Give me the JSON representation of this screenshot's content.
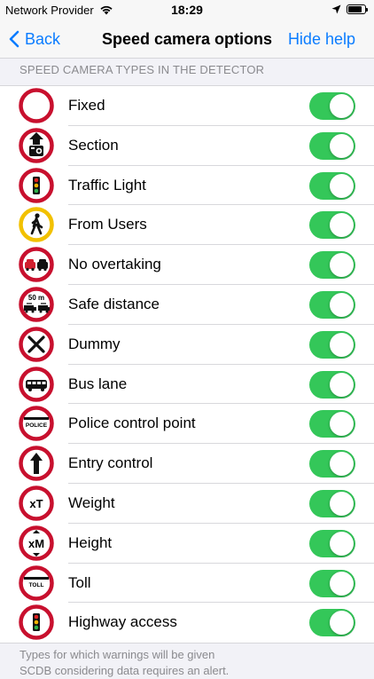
{
  "status_bar": {
    "carrier": "Network Provider",
    "time": "18:29",
    "battery_level": 0.85
  },
  "nav": {
    "back_label": "Back",
    "title": "Speed camera options",
    "help_label": "Hide help"
  },
  "section": {
    "header": "SPEED CAMERA TYPES IN THE DETECTOR",
    "footer_line1": "Types for which warnings will be given",
    "footer_line2": "SCDB considering data requires an alert."
  },
  "colors": {
    "accent": "#0a7cff",
    "toggle_on": "#34c759",
    "sign_red": "#c8102e",
    "sign_yellow": "#f2c100"
  },
  "camera_types": [
    {
      "label": "Fixed",
      "icon": "fixed-sign-icon",
      "enabled": true
    },
    {
      "label": "Section",
      "icon": "section-sign-icon",
      "enabled": true
    },
    {
      "label": "Traffic Light",
      "icon": "traffic-light-sign-icon",
      "enabled": true
    },
    {
      "label": "From Users",
      "icon": "pedestrian-sign-icon",
      "enabled": true
    },
    {
      "label": "No overtaking",
      "icon": "no-overtaking-sign-icon",
      "enabled": true
    },
    {
      "label": "Safe distance",
      "icon": "safe-distance-sign-icon",
      "enabled": true,
      "sign_text": "50 m"
    },
    {
      "label": "Dummy",
      "icon": "dummy-sign-icon",
      "enabled": true
    },
    {
      "label": "Bus lane",
      "icon": "bus-sign-icon",
      "enabled": true
    },
    {
      "label": "Police control point",
      "icon": "police-sign-icon",
      "enabled": true,
      "sign_text": "POLICE"
    },
    {
      "label": "Entry control",
      "icon": "entry-arrow-sign-icon",
      "enabled": true
    },
    {
      "label": "Weight",
      "icon": "weight-sign-icon",
      "enabled": true,
      "sign_text": "xT"
    },
    {
      "label": "Height",
      "icon": "height-sign-icon",
      "enabled": true,
      "sign_text": "xM"
    },
    {
      "label": "Toll",
      "icon": "toll-sign-icon",
      "enabled": true,
      "sign_text": "TOLL"
    },
    {
      "label": "Highway access",
      "icon": "highway-traffic-light-sign-icon",
      "enabled": true
    }
  ]
}
